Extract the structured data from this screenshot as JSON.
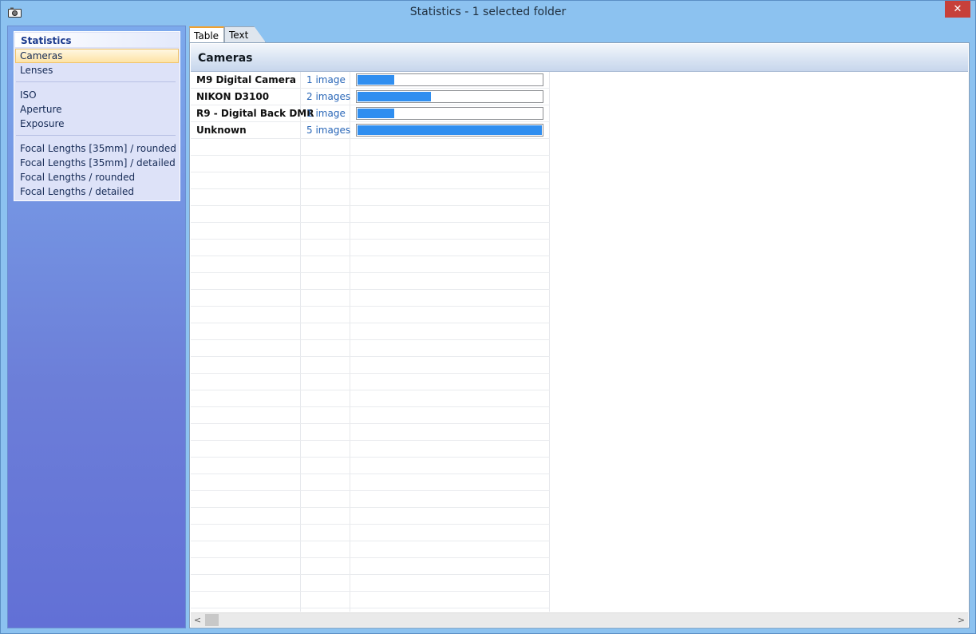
{
  "window": {
    "title": "Statistics - 1 selected folder",
    "close_glyph": "✕",
    "app_icon": "camera-icon"
  },
  "sidebar": {
    "header": "Statistics",
    "groups": [
      [
        "Cameras",
        "Lenses"
      ],
      [
        "ISO",
        "Aperture",
        "Exposure"
      ],
      [
        "Focal Lengths [35mm] / rounded",
        "Focal Lengths [35mm] / detailed",
        "Focal Lengths / rounded",
        "Focal Lengths / detailed"
      ]
    ],
    "selected": "Cameras"
  },
  "tabs": {
    "table_label": "Table",
    "text_label": "Text",
    "active": "Table"
  },
  "section": {
    "title": "Cameras"
  },
  "rows": [
    {
      "name": "M9 Digital Camera",
      "count": "1 image",
      "fraction": 0.2
    },
    {
      "name": "NIKON D3100",
      "count": "2 images",
      "fraction": 0.4
    },
    {
      "name": "R9 - Digital Back DMR",
      "count": "1 image",
      "fraction": 0.2
    },
    {
      "name": "Unknown",
      "count": "5 images",
      "fraction": 1.0
    }
  ],
  "scrollbar": {
    "left_glyph": "<",
    "right_glyph": ">"
  },
  "colors": {
    "bar_fill": "#2f8ef0",
    "count_text": "#2a67b8",
    "active_tab_accent": "#f0a02e",
    "close_button": "#c7403a"
  }
}
